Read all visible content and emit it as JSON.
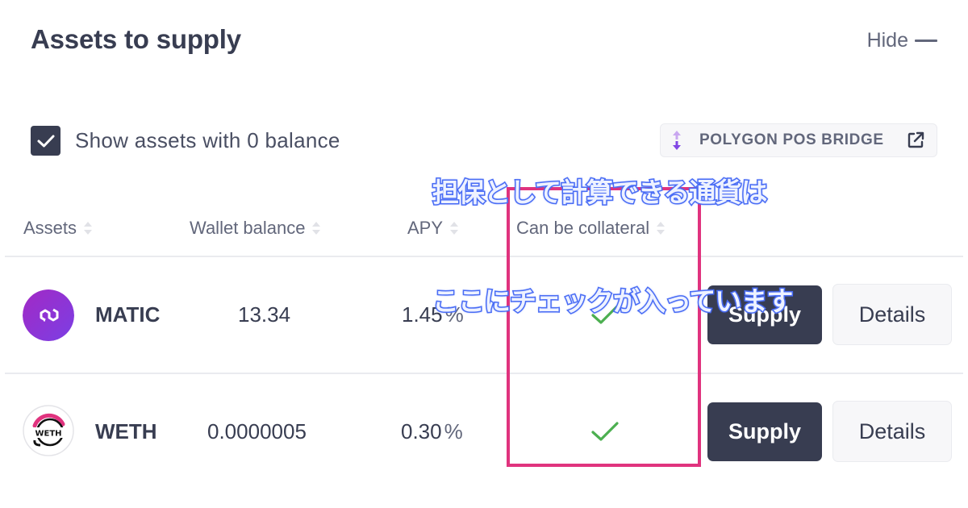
{
  "header": {
    "title": "Assets to supply",
    "hide_label": "Hide"
  },
  "toolbar": {
    "show_zero_balance_label": "Show assets with 0 balance",
    "show_zero_balance_checked": true,
    "bridge_button_label": "POLYGON POS BRIDGE"
  },
  "table": {
    "columns": [
      {
        "label": "Assets"
      },
      {
        "label": "Wallet balance"
      },
      {
        "label": "APY"
      },
      {
        "label": "Can be collateral"
      }
    ],
    "rows": [
      {
        "icon": "polygon-matic-icon",
        "symbol": "MATIC",
        "wallet_balance": "13.34",
        "apy": "1.45",
        "apy_unit": "%",
        "can_be_collateral": true,
        "supply_label": "Supply",
        "details_label": "Details"
      },
      {
        "icon": "weth-icon",
        "symbol": "WETH",
        "wallet_balance": "0.0000005",
        "apy": "0.30",
        "apy_unit": "%",
        "can_be_collateral": true,
        "supply_label": "Supply",
        "details_label": "Details"
      }
    ]
  },
  "annotation": {
    "line1": "担保として計算できる通貨は",
    "line2": "ここにチェックが入っています",
    "highlight_color": "#e0337e",
    "text_outline_color": "#4a6df5"
  },
  "colors": {
    "primary_dark": "#383d51",
    "secondary_text": "#62677b",
    "check_green": "#4caf50",
    "matic_purple": "#8247e5"
  }
}
